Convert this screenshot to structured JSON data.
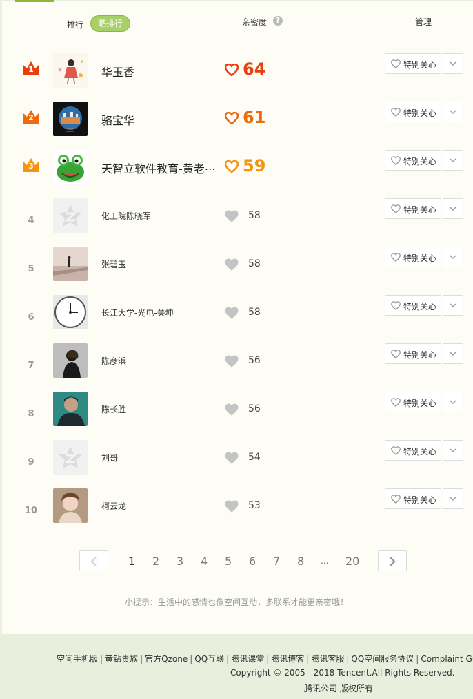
{
  "header": {
    "rank_label": "排行",
    "sun_rank_label": "晒排行",
    "intimacy_label": "亲密度",
    "help_glyph": "?",
    "manage_label": "管理"
  },
  "rows": [
    {
      "rank": "1",
      "name": "华玉香",
      "score": "64",
      "care_label": "特别关心"
    },
    {
      "rank": "2",
      "name": "骆宝华",
      "score": "61",
      "care_label": "特别关心"
    },
    {
      "rank": "3",
      "name": "天智立软件教育-黄老⋯",
      "score": "59",
      "care_label": "特别关心"
    },
    {
      "rank": "4",
      "name": "化工院陈晓军",
      "score": "58",
      "care_label": "特别关心"
    },
    {
      "rank": "5",
      "name": "张碧玉",
      "score": "58",
      "care_label": "特别关心"
    },
    {
      "rank": "6",
      "name": "长江大学-光电-关坤",
      "score": "58",
      "care_label": "特别关心"
    },
    {
      "rank": "7",
      "name": "陈彦浜",
      "score": "56",
      "care_label": "特别关心"
    },
    {
      "rank": "8",
      "name": "陈长胜",
      "score": "56",
      "care_label": "特别关心"
    },
    {
      "rank": "9",
      "name": "刘哥",
      "score": "54",
      "care_label": "特别关心"
    },
    {
      "rank": "10",
      "name": "柯云龙",
      "score": "53",
      "care_label": "特别关心"
    }
  ],
  "colors": {
    "gold_1": "#e8400c",
    "gold_2": "#f06a0c",
    "gold_3": "#f5940f",
    "accent": "#8ab83b",
    "heart_gray": "#c4c4c4"
  },
  "pagination": {
    "pages": [
      "1",
      "2",
      "3",
      "4",
      "5",
      "6",
      "7",
      "8",
      "...",
      "20"
    ],
    "current": "1"
  },
  "tip": "小提示：生活中的感情也像空间互动，多联系才能更亲密哦！",
  "footer": {
    "links": [
      "空间手机版",
      "黄钻贵族",
      "官方Qzone",
      "QQ互联",
      "腾讯课堂",
      "腾讯博客",
      "腾讯客服",
      "QQ空间服务协议",
      "Complaint Guidelines"
    ],
    "copyright": "Copyright © 2005 - 2018 Tencent.All Rights Reserved.",
    "owner": "腾讯公司 版权所有"
  },
  "avatars": [
    "illustration-girl",
    "harbor-city",
    "green-frog",
    "qzone-default",
    "person-on-pier",
    "wall-clock",
    "silhouette",
    "man-portrait",
    "qzone-default",
    "child-photo"
  ]
}
